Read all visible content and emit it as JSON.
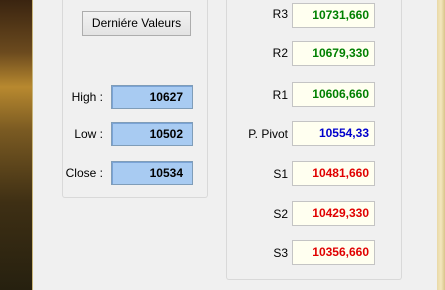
{
  "button": {
    "label": "Derniére Valeurs"
  },
  "inputs": [
    {
      "label": "High :",
      "value": "10627"
    },
    {
      "label": "Low :",
      "value": "10502"
    },
    {
      "label": "Close :",
      "value": "10534"
    }
  ],
  "pivots": [
    {
      "label": "R3",
      "value": "10731,660",
      "color": "#008000"
    },
    {
      "label": "R2",
      "value": "10679,330",
      "color": "#008000"
    },
    {
      "label": "R1",
      "value": "10606,660",
      "color": "#008000"
    },
    {
      "label": "P. Pivot",
      "value": "10554,33",
      "color": "#0000cc"
    },
    {
      "label": "S1",
      "value": "10481,660",
      "color": "#e00000"
    },
    {
      "label": "S2",
      "value": "10429,330",
      "color": "#e00000"
    },
    {
      "label": "S3",
      "value": "10356,660",
      "color": "#e00000"
    }
  ]
}
